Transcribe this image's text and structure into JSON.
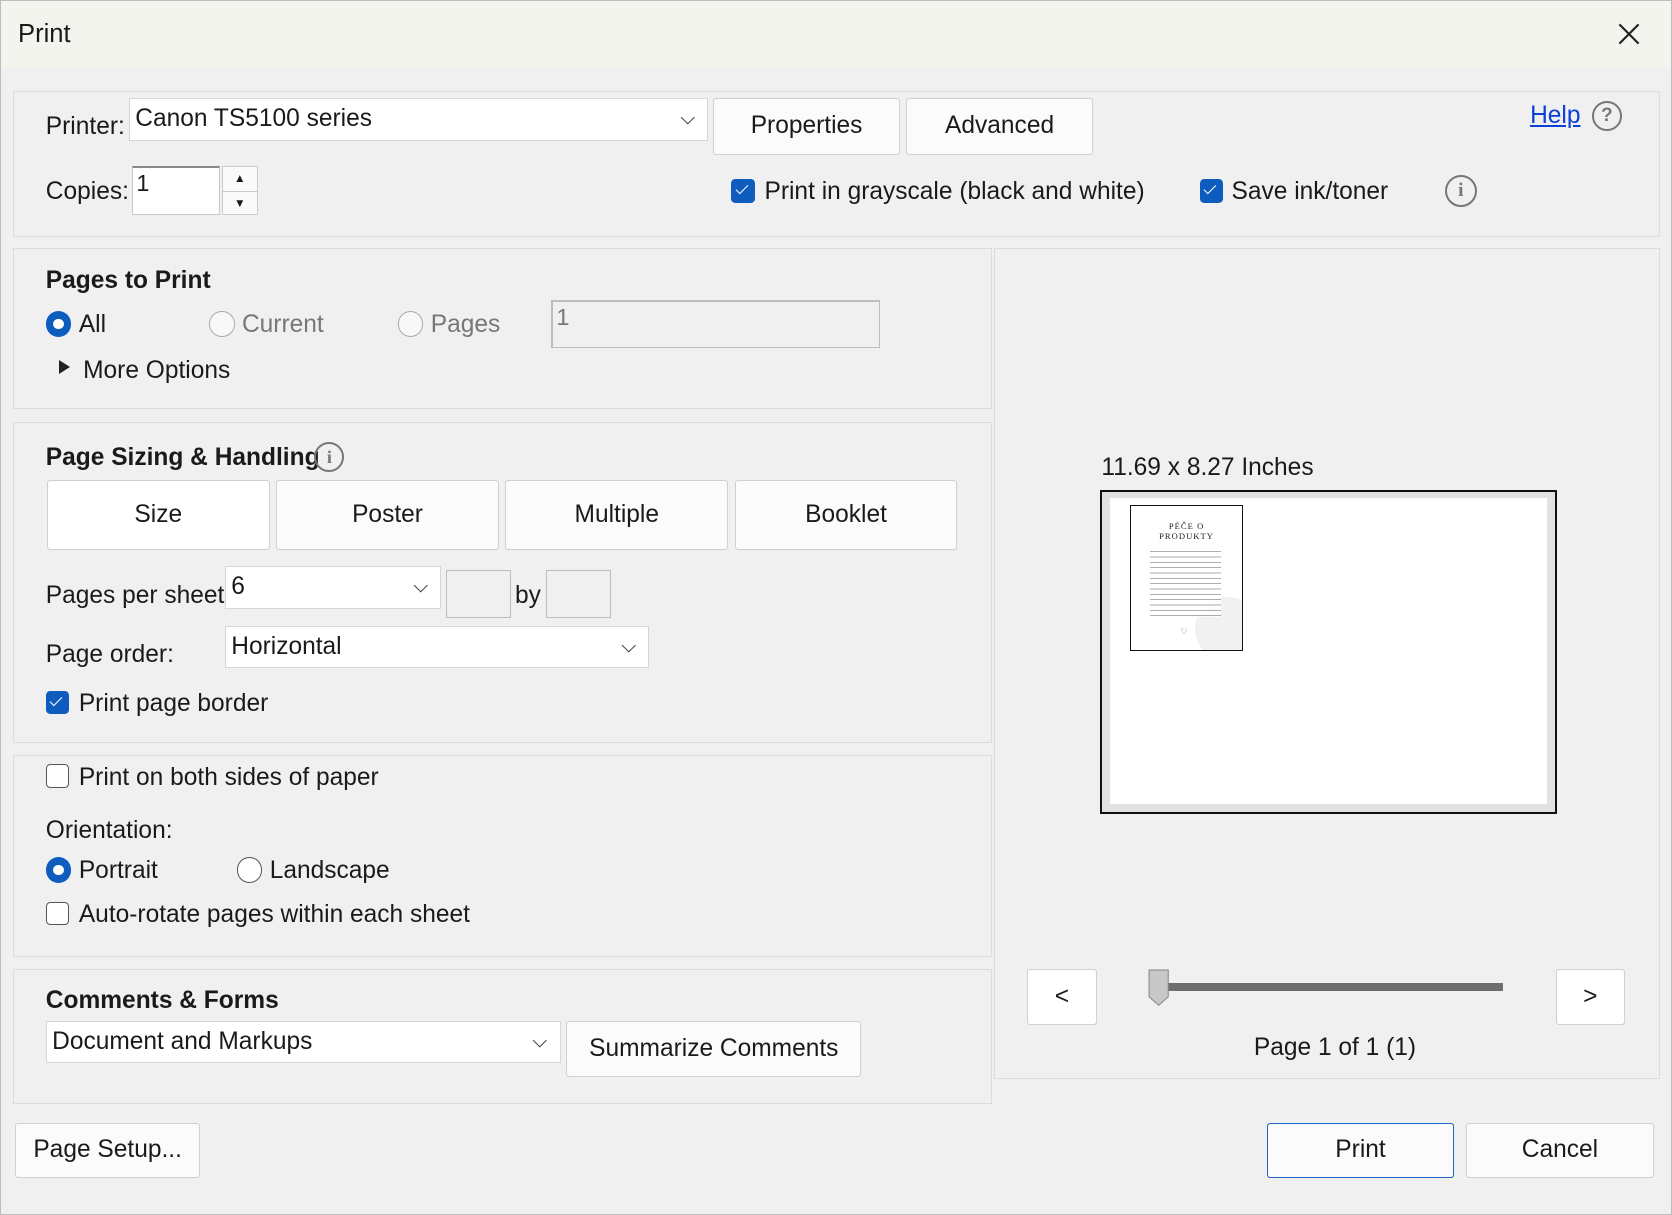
{
  "window": {
    "title": "Print",
    "close_icon": "close-icon"
  },
  "printer": {
    "label": "Printer:",
    "selected": "Canon TS5100 series",
    "properties_label": "Properties",
    "advanced_label": "Advanced",
    "help_label": "Help",
    "copies_label": "Copies:",
    "copies_value": "1",
    "grayscale_label": "Print in grayscale (black and white)",
    "grayscale_checked": true,
    "save_ink_label": "Save ink/toner",
    "save_ink_checked": true
  },
  "pages_to_print": {
    "heading": "Pages to Print",
    "all_label": "All",
    "current_label": "Current",
    "pages_label": "Pages",
    "pages_value": "1",
    "selected": "All",
    "more_options_label": "More Options"
  },
  "sizing": {
    "heading": "Page Sizing & Handling",
    "tabs": [
      "Size",
      "Poster",
      "Multiple",
      "Booklet"
    ],
    "pages_per_sheet_label": "Pages per sheet:",
    "pages_per_sheet_value": "6",
    "by_label": "by",
    "page_order_label": "Page order:",
    "page_order_value": "Horizontal",
    "border_label": "Print page border",
    "border_checked": true
  },
  "layout": {
    "both_sides_label": "Print on both sides of paper",
    "both_sides_checked": false,
    "orientation_label": "Orientation:",
    "portrait_label": "Portrait",
    "landscape_label": "Landscape",
    "orientation_selected": "Portrait",
    "autorotate_label": "Auto-rotate pages within each sheet",
    "autorotate_checked": false
  },
  "comments": {
    "heading": "Comments & Forms",
    "selected": "Document and Markups",
    "summarize_label": "Summarize Comments"
  },
  "preview": {
    "size_label": "11.69 x 8.27 Inches",
    "thumb_title_1": "PÉČE O",
    "thumb_title_2": "PRODUKTY",
    "prev_label": "<",
    "next_label": ">",
    "page_status": "Page 1 of 1 (1)",
    "slider_position": 0
  },
  "footer": {
    "page_setup_label": "Page Setup...",
    "print_label": "Print",
    "cancel_label": "Cancel"
  },
  "colors": {
    "accent": "#0f5cbf",
    "link": "#0b3fd6"
  }
}
